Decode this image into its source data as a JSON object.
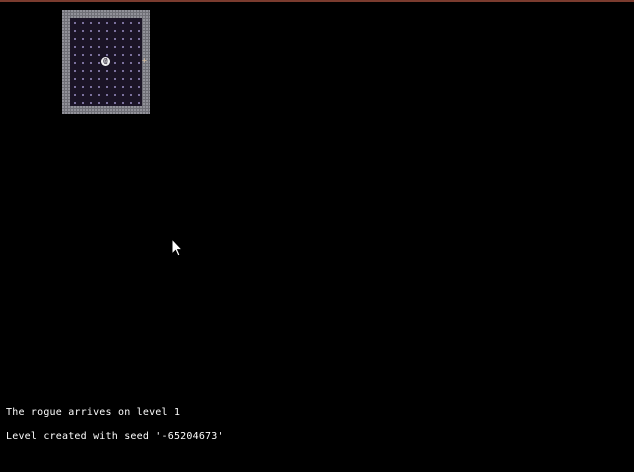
{
  "map": {
    "player_glyph": "@",
    "door_glyph": "+",
    "colors": {
      "wall": "#6f6f76",
      "floor": "#1b1426",
      "floor_dot": "#8a7fb0",
      "player": "#f2f2f2",
      "door": "#c9b49a",
      "top_border": "#7a3b2e"
    }
  },
  "messages": [
    "The rogue arrives on level 1",
    "Level created with seed '-65204673'"
  ],
  "icons": {
    "cursor": "mouse-pointer-icon"
  }
}
